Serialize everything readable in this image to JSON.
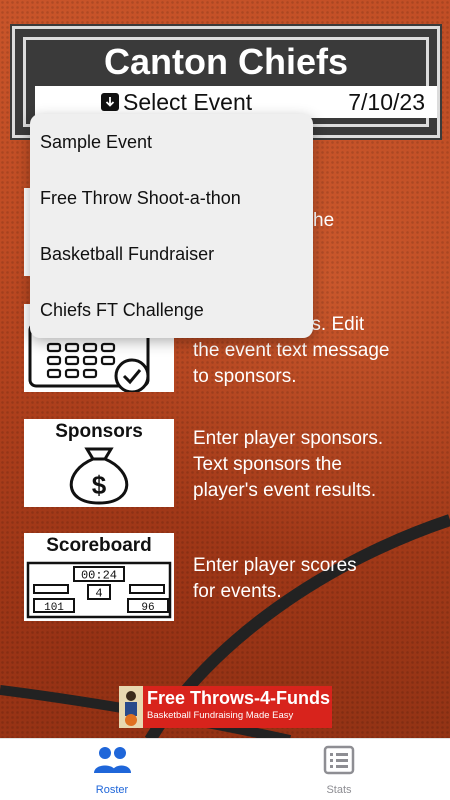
{
  "app": {
    "title": "Canton Chiefs",
    "select_event_label": "Select Event",
    "date": "7/10/23"
  },
  "dropdown": {
    "items": [
      {
        "label": "Sample Event"
      },
      {
        "label": "Free Throw Shoot-a-thon"
      },
      {
        "label": "Basketball Fundraiser"
      },
      {
        "label": "Chiefs FT Challenge"
      }
    ]
  },
  "features": [
    {
      "icon": "roster-icon",
      "title": "",
      "desc_line1": "it the"
    },
    {
      "icon": "calendar-icon",
      "title": "",
      "desc_line1": "ents. Edit",
      "desc_line2": "the event text message",
      "desc_line3": "to sponsors."
    },
    {
      "icon": "money-bag-icon",
      "title": "Sponsors",
      "desc_line1": "Enter player sponsors.",
      "desc_line2": "Text sponsors the",
      "desc_line3": "player's event results."
    },
    {
      "icon": "scoreboard-icon",
      "title": "Scoreboard",
      "desc_line1": "Enter player scores",
      "desc_line2": "for events.",
      "clock": "00:24",
      "period": "4",
      "home": "101",
      "away": "96"
    }
  ],
  "banner": {
    "title": "Free Throws-4-Funds",
    "subtitle": "Basketball Fundraising Made Easy"
  },
  "tabs": [
    {
      "label": "Roster",
      "active": true,
      "color": "#1f66d9"
    },
    {
      "label": "Stats",
      "active": false,
      "color": "#8e8e93"
    }
  ]
}
